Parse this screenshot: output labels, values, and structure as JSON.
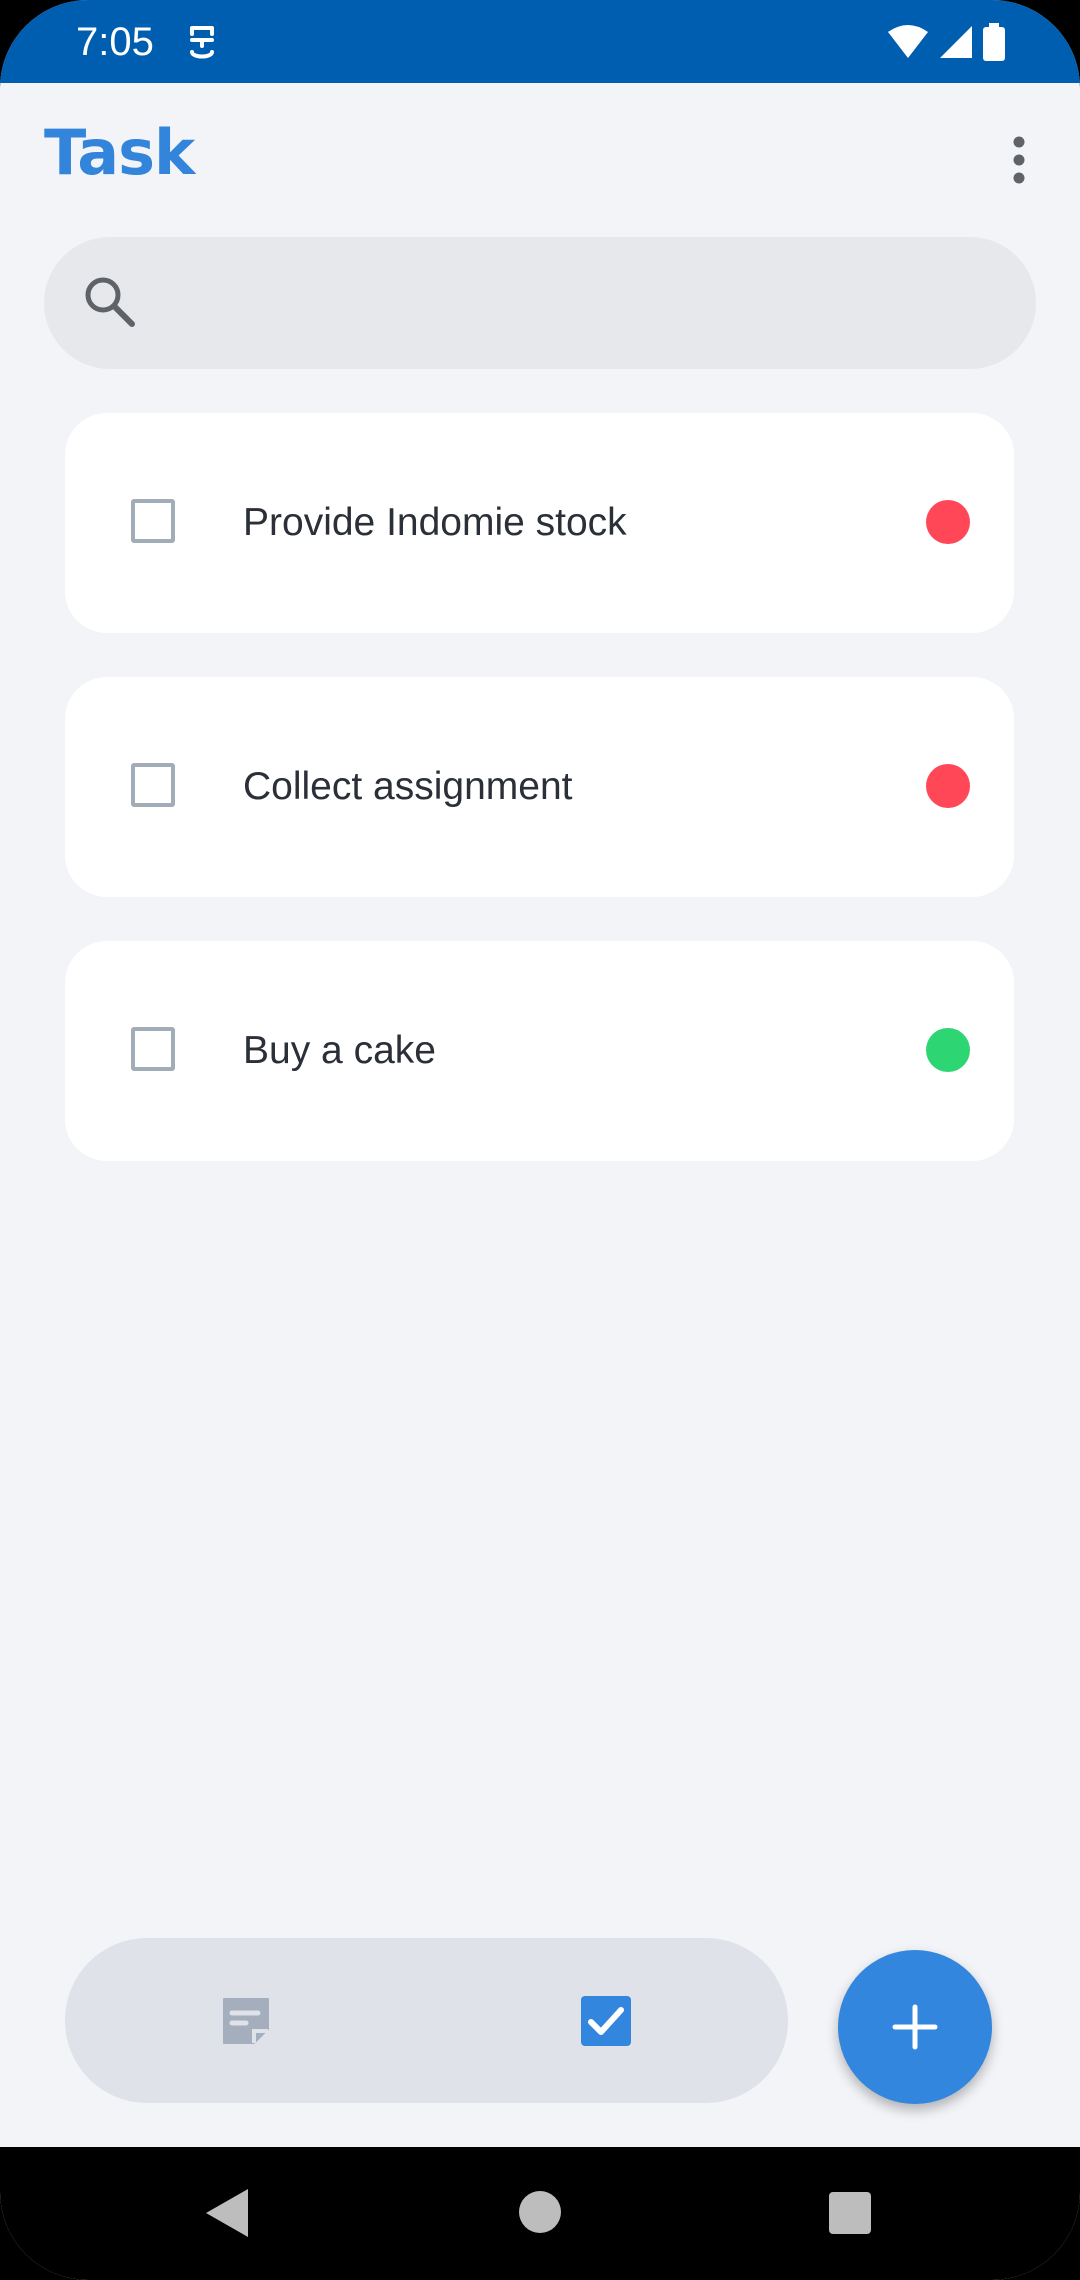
{
  "status_bar": {
    "time": "7:05",
    "background_color": "#005eb0",
    "icons": [
      "app-notification-icon",
      "wifi-icon",
      "signal-icon",
      "battery-icon"
    ]
  },
  "header": {
    "title": "Task",
    "title_color": "#3385db",
    "menu_icon": "more-vert-icon"
  },
  "search": {
    "value": "",
    "placeholder": "",
    "icon": "search-icon"
  },
  "tasks": [
    {
      "label": "Provide Indomie stock",
      "checked": false,
      "priority_color": "#ff4757"
    },
    {
      "label": "Collect assignment",
      "checked": false,
      "priority_color": "#ff4757"
    },
    {
      "label": "Buy a cake",
      "checked": false,
      "priority_color": "#2ed573"
    }
  ],
  "bottom_nav": {
    "items": [
      {
        "icon": "notes-icon",
        "active": false,
        "color": "#a4aebd"
      },
      {
        "icon": "check-box-icon",
        "active": true,
        "color": "#3286de"
      }
    ]
  },
  "fab": {
    "icon": "plus-icon",
    "color": "#3286de"
  },
  "system_nav": {
    "icons": [
      "back-icon",
      "home-icon",
      "recents-icon"
    ]
  }
}
